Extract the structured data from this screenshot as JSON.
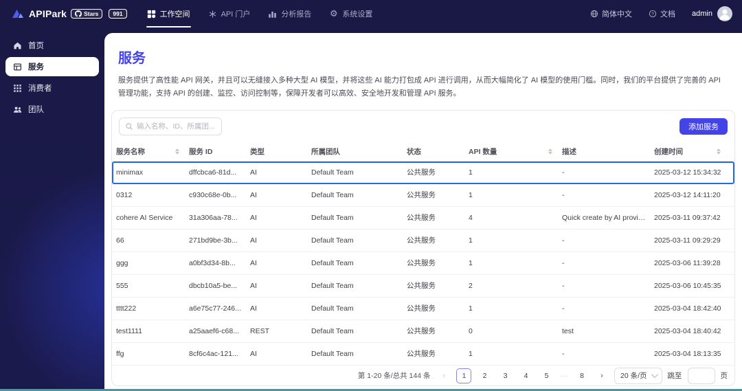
{
  "colors": {
    "primary": "#4443e6",
    "selected_row_border": "#2468e5",
    "navbar_bg": "#1a1945",
    "add_button_bg": "#4443e6",
    "bottom_strip": "#55929b"
  },
  "navbar": {
    "logo_text": "APIPark",
    "github": {
      "label": "Stars",
      "count": "991"
    },
    "menu": [
      {
        "name": "workspace",
        "label": "工作空间",
        "icon": "workspace-icon",
        "active": true
      },
      {
        "name": "api-portal",
        "label": "API 门户",
        "icon": "api-portal-icon",
        "active": false
      },
      {
        "name": "analytics",
        "label": "分析报告",
        "icon": "bar-chart-icon",
        "active": false
      },
      {
        "name": "settings",
        "label": "系统设置",
        "icon": "gear-icon",
        "active": false
      }
    ],
    "language": "简体中文",
    "docs": "文档",
    "user": "admin"
  },
  "sidebar": {
    "items": [
      {
        "name": "home",
        "label": "首页",
        "icon": "home-icon",
        "active": false
      },
      {
        "name": "services",
        "label": "服务",
        "icon": "services-icon",
        "active": true
      },
      {
        "name": "consumers",
        "label": "消费者",
        "icon": "consumers-grid-icon",
        "active": false
      },
      {
        "name": "teams",
        "label": "团队",
        "icon": "teams-icon",
        "active": false
      }
    ]
  },
  "page": {
    "title": "服务",
    "description": "服务提供了高性能 API 网关，并且可以无缝接入多种大型 AI 模型，并将这些 AI 能力打包成 API 进行调用，从而大幅简化了 AI 模型的使用门槛。同时，我们的平台提供了完善的 API 管理功能，支持 API 的创建、监控、访问控制等，保障开发者可以高效、安全地开发和管理 API 服务。",
    "search_placeholder": "输入名称、ID、所属团...",
    "add_button": "添加服务"
  },
  "table": {
    "columns": [
      {
        "label": "服务名称",
        "sortable": true
      },
      {
        "label": "服务 ID",
        "sortable": false
      },
      {
        "label": "类型",
        "sortable": false
      },
      {
        "label": "所属团队",
        "sortable": false
      },
      {
        "label": "状态",
        "sortable": false
      },
      {
        "label": "API 数量",
        "sortable": true
      },
      {
        "label": "描述",
        "sortable": false
      },
      {
        "label": "创建时间",
        "sortable": true
      }
    ],
    "rows": [
      {
        "name": "minimax",
        "id": "dffcbca6-81d...",
        "type": "AI",
        "team": "Default Team",
        "status": "公共服务",
        "api_count": "1",
        "description": "-",
        "created": "2025-03-12 15:34:32",
        "selected": true
      },
      {
        "name": "0312",
        "id": "c930c68e-0b...",
        "type": "AI",
        "team": "Default Team",
        "status": "公共服务",
        "api_count": "1",
        "description": "-",
        "created": "2025-03-12 14:11:20",
        "selected": false
      },
      {
        "name": "cohere AI Service",
        "id": "31a306aa-78...",
        "type": "AI",
        "team": "Default Team",
        "status": "公共服务",
        "api_count": "4",
        "description": "Quick create by AI provider",
        "created": "2025-03-11 09:37:42",
        "selected": false
      },
      {
        "name": "66",
        "id": "271bd9be-3b...",
        "type": "AI",
        "team": "Default Team",
        "status": "公共服务",
        "api_count": "1",
        "description": "-",
        "created": "2025-03-11 09:29:29",
        "selected": false
      },
      {
        "name": "ggg",
        "id": "a0bf3d34-8b...",
        "type": "AI",
        "team": "Default Team",
        "status": "公共服务",
        "api_count": "1",
        "description": "-",
        "created": "2025-03-06 11:39:28",
        "selected": false
      },
      {
        "name": "555",
        "id": "dbcb10a5-be...",
        "type": "AI",
        "team": "Default Team",
        "status": "公共服务",
        "api_count": "2",
        "description": "-",
        "created": "2025-03-06 10:45:35",
        "selected": false
      },
      {
        "name": "tttt222",
        "id": "a6e75c77-246...",
        "type": "AI",
        "team": "Default Team",
        "status": "公共服务",
        "api_count": "1",
        "description": "-",
        "created": "2025-03-04 18:42:40",
        "selected": false
      },
      {
        "name": "test1111",
        "id": "a25aaef6-c68...",
        "type": "REST",
        "team": "Default Team",
        "status": "公共服务",
        "api_count": "0",
        "description": "test",
        "created": "2025-03-04 18:40:42",
        "selected": false
      },
      {
        "name": "ffg",
        "id": "8cf6c4ac-121...",
        "type": "AI",
        "team": "Default Team",
        "status": "公共服务",
        "api_count": "1",
        "description": "-",
        "created": "2025-03-04 18:13:35",
        "selected": false
      }
    ]
  },
  "pagination": {
    "total_text": "第 1-20 条/总共 144 条",
    "prev_icon": "‹",
    "next_icon": "›",
    "pages": [
      "1",
      "2",
      "3",
      "4",
      "5",
      "···",
      "8"
    ],
    "active_page": "1",
    "page_size": "20 条/页",
    "jump_prefix": "跳至",
    "jump_suffix": "页"
  }
}
